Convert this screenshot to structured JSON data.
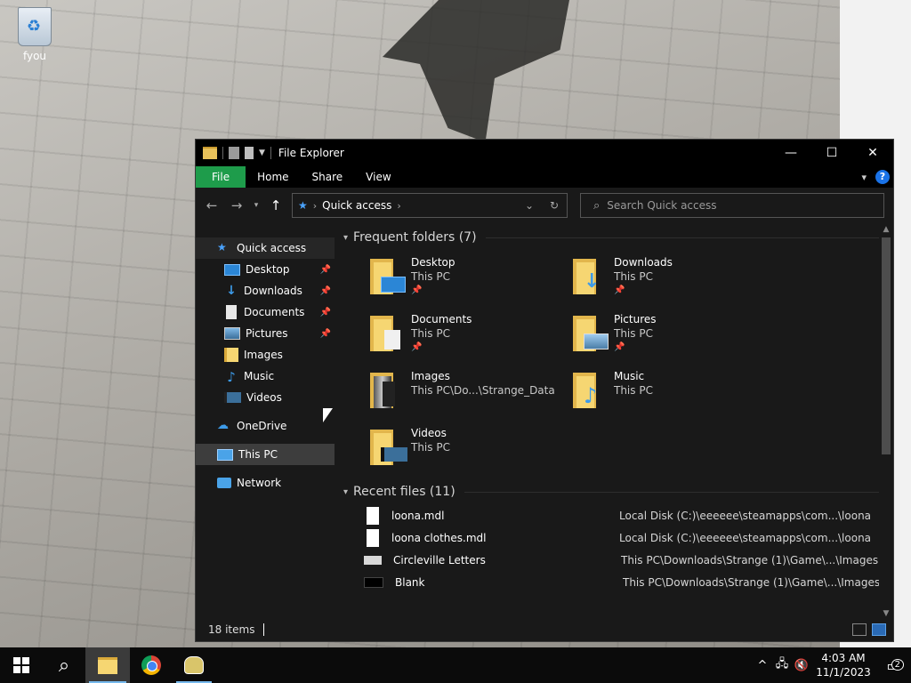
{
  "desktop": {
    "icon_label": "fyou"
  },
  "window": {
    "title": "File Explorer",
    "ribbon_tabs": [
      "File",
      "Home",
      "Share",
      "View"
    ],
    "help": "?",
    "address": {
      "location": "Quick access"
    },
    "search_placeholder": "Search Quick access"
  },
  "sidebar": {
    "quick_access": "Quick access",
    "items": [
      {
        "label": "Desktop",
        "pinned": true,
        "icon": "desktop-icon"
      },
      {
        "label": "Downloads",
        "pinned": true,
        "icon": "downloads-icon"
      },
      {
        "label": "Documents",
        "pinned": true,
        "icon": "documents-icon"
      },
      {
        "label": "Pictures",
        "pinned": true,
        "icon": "pictures-icon"
      },
      {
        "label": "Images",
        "pinned": false,
        "icon": "folder-icon"
      },
      {
        "label": "Music",
        "pinned": false,
        "icon": "music-icon"
      },
      {
        "label": "Videos",
        "pinned": false,
        "icon": "videos-icon"
      }
    ],
    "onedrive": "OneDrive",
    "this_pc": "This PC",
    "network": "Network"
  },
  "frequent": {
    "header": "Frequent folders (7)",
    "folders": [
      {
        "name": "Desktop",
        "loc": "This PC",
        "pinned": true
      },
      {
        "name": "Downloads",
        "loc": "This PC",
        "pinned": true
      },
      {
        "name": "Documents",
        "loc": "This PC",
        "pinned": true
      },
      {
        "name": "Pictures",
        "loc": "This PC",
        "pinned": true
      },
      {
        "name": "Images",
        "loc": "This PC\\Do...\\Strange_Data",
        "pinned": false
      },
      {
        "name": "Music",
        "loc": "This PC",
        "pinned": false
      },
      {
        "name": "Videos",
        "loc": "This PC",
        "pinned": false
      }
    ]
  },
  "recent": {
    "header": "Recent files (11)",
    "files": [
      {
        "name": "loona.mdl",
        "loc": "Local Disk (C:)\\eeeeee\\steamapps\\com...\\loona"
      },
      {
        "name": "loona clothes.mdl",
        "loc": "Local Disk (C:)\\eeeeee\\steamapps\\com...\\loona"
      },
      {
        "name": "Circleville Letters",
        "loc": "This PC\\Downloads\\Strange (1)\\Game\\...\\Images"
      },
      {
        "name": "Blank",
        "loc": "This PC\\Downloads\\Strange (1)\\Game\\...\\Images"
      }
    ]
  },
  "status": {
    "items": "18 items"
  },
  "taskbar": {
    "time": "4:03 AM",
    "date": "11/1/2023",
    "notifications": "2"
  },
  "colors": {
    "accent": "#1e9c4b",
    "quick_access_star": "#4aa3ff",
    "folder": "#f6d672"
  }
}
